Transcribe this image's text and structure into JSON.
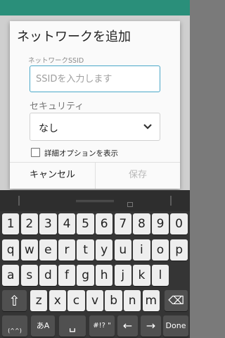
{
  "dialog": {
    "title": "ネットワークを追加",
    "ssid_label": "ネットワークSSID",
    "ssid_placeholder": "SSIDを入力します",
    "ssid_value": "",
    "security_label": "セキュリティ",
    "security_value": "なし",
    "advanced_label": "詳細オプションを表示",
    "cancel_label": "キャンセル",
    "save_label": "保存"
  },
  "keyboard": {
    "row_numbers": [
      "1",
      "2",
      "3",
      "4",
      "5",
      "6",
      "7",
      "8",
      "9",
      "0"
    ],
    "row_q": [
      "q",
      "w",
      "e",
      "r",
      "t",
      "y",
      "u",
      "i",
      "o",
      "p"
    ],
    "row_a": [
      "a",
      "s",
      "d",
      "f",
      "g",
      "h",
      "j",
      "k",
      "l"
    ],
    "row_z": [
      "z",
      "x",
      "c",
      "v",
      "b",
      "n",
      "m"
    ],
    "shift": "⇧",
    "backspace": "⌫",
    "mode": "あA",
    "symbols": "#!? \"",
    "left": "←",
    "right": "→",
    "done": "Done",
    "emoticon": "(^^)"
  }
}
